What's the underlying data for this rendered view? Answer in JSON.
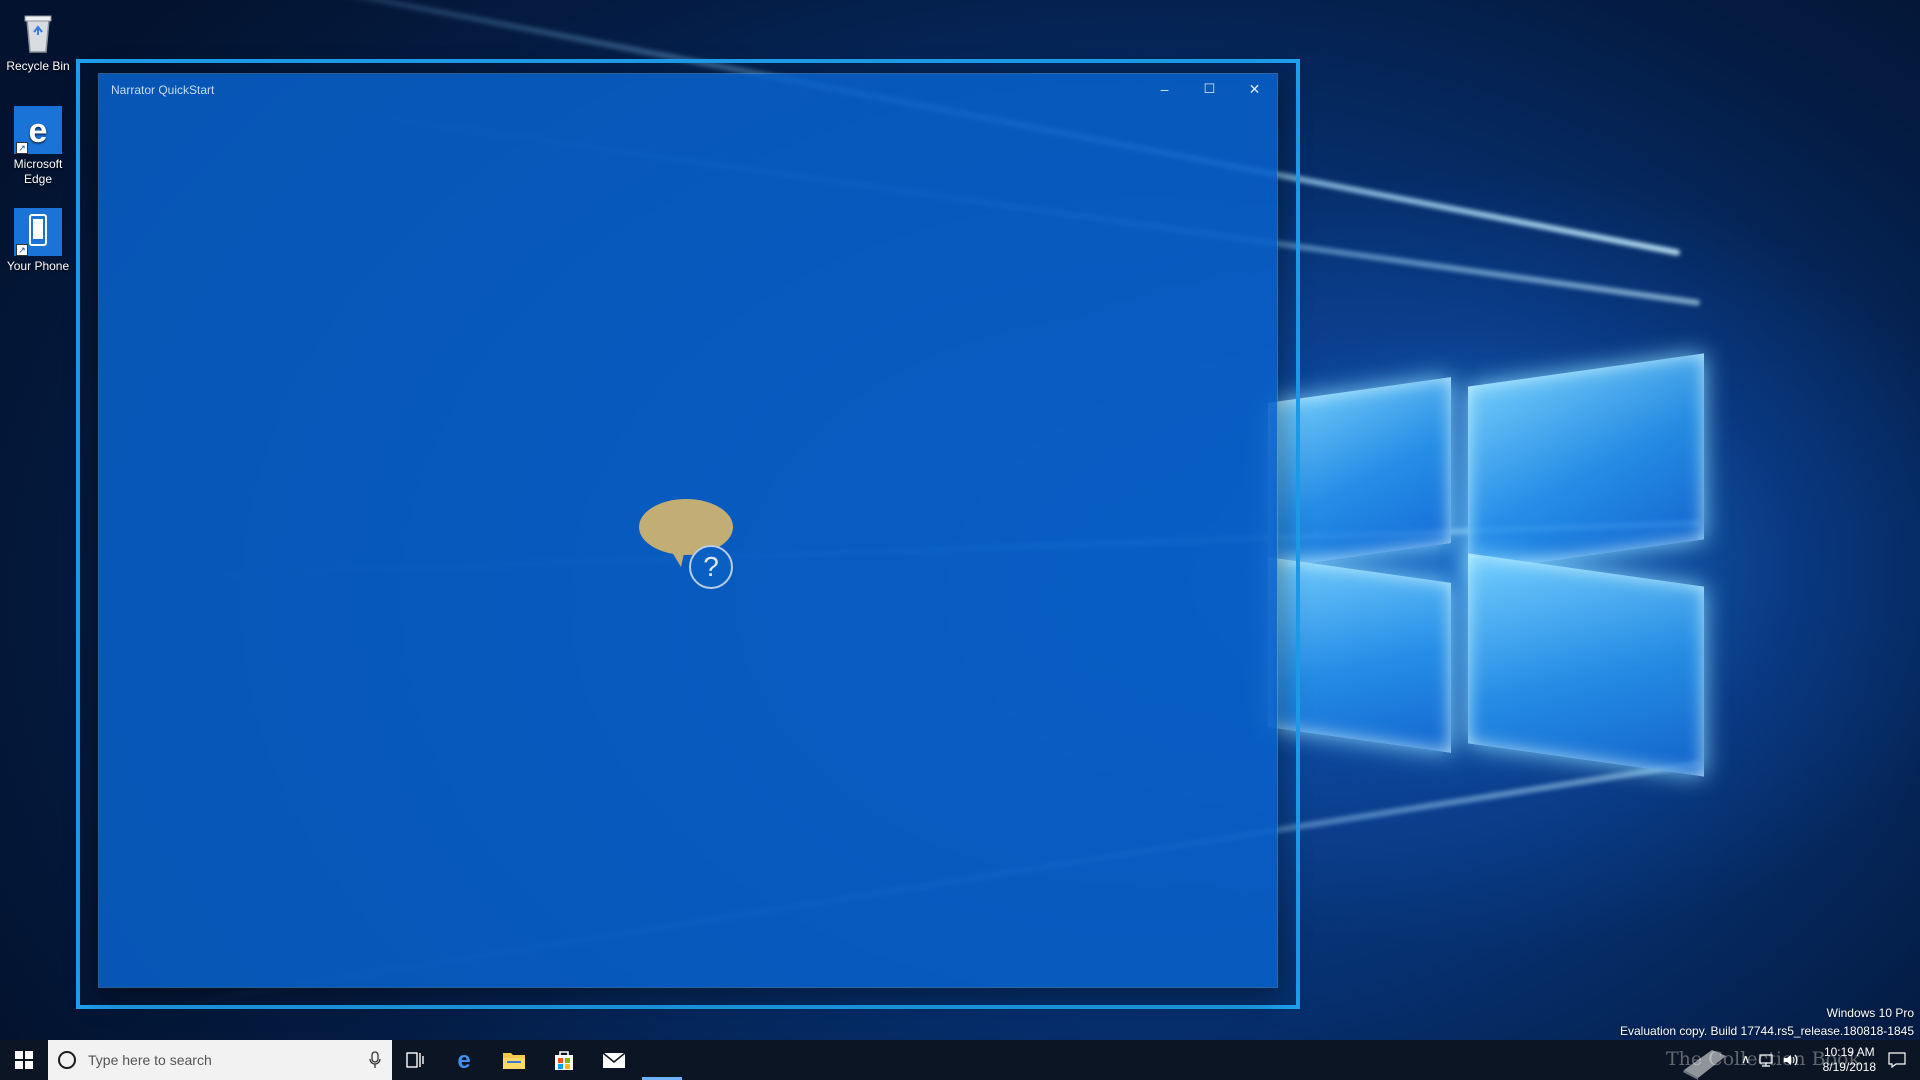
{
  "desktop": {
    "icons": [
      {
        "label": "Recycle Bin",
        "icon": "recycle-bin-icon"
      },
      {
        "label": "Microsoft Edge",
        "icon": "edge-icon"
      },
      {
        "label": "Your Phone",
        "icon": "phone-icon"
      }
    ]
  },
  "window": {
    "title": "Narrator QuickStart",
    "minimize_glyph": "–",
    "maximize_glyph": "☐",
    "close_glyph": "✕",
    "illustration": "speech-bubble-question-icon",
    "question_mark": "?"
  },
  "watermark": {
    "edition": "Windows 10 Pro",
    "build": "Evaluation copy. Build 17744.rs5_release.180818-1845"
  },
  "taskbar": {
    "search_placeholder": "Type here to search",
    "pinned": [
      "task-view-icon",
      "edge-icon",
      "file-explorer-icon",
      "store-icon",
      "mail-icon"
    ],
    "clock_time": "10:19 AM",
    "clock_date": "8/19/2018",
    "overlay_logo_text": "The Collection Book"
  },
  "colors": {
    "focus_border": "#1ea0f0",
    "window_bg": "#0860c8",
    "taskbar_bg": "#0b1523",
    "bubble": "#c2ae74"
  }
}
